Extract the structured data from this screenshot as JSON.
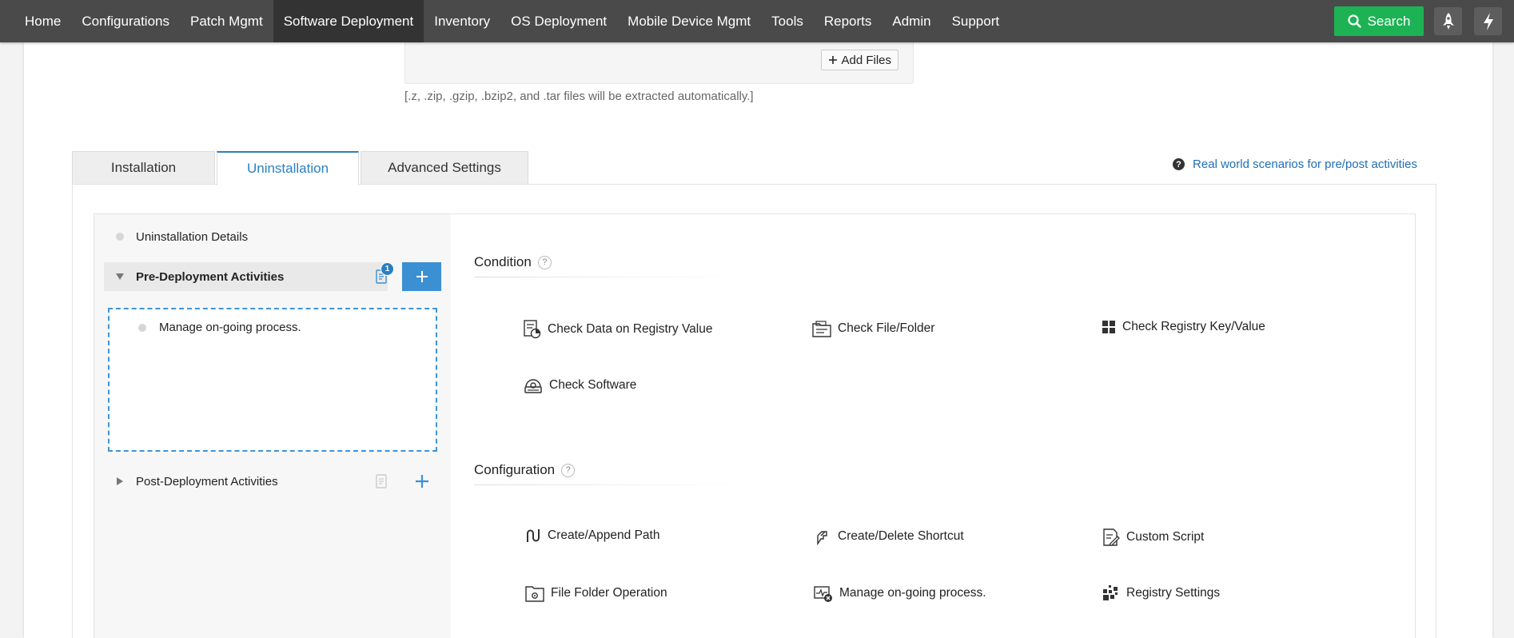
{
  "nav": {
    "items": [
      {
        "label": "Home"
      },
      {
        "label": "Configurations"
      },
      {
        "label": "Patch Mgmt"
      },
      {
        "label": "Software Deployment"
      },
      {
        "label": "Inventory"
      },
      {
        "label": "OS Deployment"
      },
      {
        "label": "Mobile Device Mgmt"
      },
      {
        "label": "Tools"
      },
      {
        "label": "Reports"
      },
      {
        "label": "Admin"
      },
      {
        "label": "Support"
      }
    ],
    "active": "Software Deployment",
    "search_label": "Search",
    "icons": [
      "rocket-icon",
      "lightning-icon"
    ]
  },
  "upload": {
    "add_files_label": "Add Files",
    "note": "[.z, .zip, .gzip, .bzip2, and .tar files will be extracted automatically.]"
  },
  "tabs": [
    {
      "label": "Installation"
    },
    {
      "label": "Uninstallation"
    },
    {
      "label": "Advanced Settings"
    }
  ],
  "active_tab": "Uninstallation",
  "help_link": "Real world scenarios for pre/post activities",
  "left_pane": {
    "details_label": "Uninstallation Details",
    "pre_label": "Pre-Deployment Activities",
    "pre_badge": "1",
    "pre_items": [
      {
        "label": "Manage on-going process."
      }
    ],
    "post_label": "Post-Deployment Activities"
  },
  "condition": {
    "heading": "Condition",
    "help": "?",
    "items": [
      {
        "label": "Check Data on Registry Value",
        "icon": "registry-data-icon"
      },
      {
        "label": "Check File/Folder",
        "icon": "file-folder-icon"
      },
      {
        "label": "Check Registry Key/Value",
        "icon": "registry-key-icon"
      },
      {
        "label": "Check Software",
        "icon": "software-icon"
      }
    ]
  },
  "configuration": {
    "heading": "Configuration",
    "help": "?",
    "items": [
      {
        "label": "Create/Append Path",
        "icon": "path-icon"
      },
      {
        "label": "Create/Delete Shortcut",
        "icon": "shortcut-icon"
      },
      {
        "label": "Custom Script",
        "icon": "script-icon"
      },
      {
        "label": "File Folder Operation",
        "icon": "folder-gear-icon"
      },
      {
        "label": "Manage on-going process.",
        "icon": "process-icon"
      },
      {
        "label": "Registry Settings",
        "icon": "registry-settings-icon"
      }
    ]
  },
  "colors": {
    "nav_bg": "#4a4a4a",
    "search_green": "#1db355",
    "accent_blue": "#2b7fc1",
    "add_blue": "#3b8fd3"
  }
}
